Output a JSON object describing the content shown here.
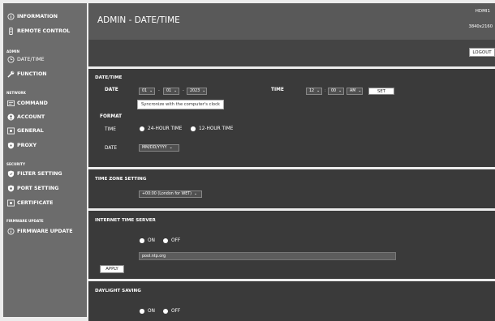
{
  "sidebar": {
    "information": "INFORMATION",
    "remote_control": "REMOTE CONTROL",
    "cat_admin": "ADMIN",
    "date_time": "DATE/TIME",
    "function": "FUNCTION",
    "cat_network": "NETWORK",
    "command": "COMMAND",
    "account": "ACCOUNT",
    "general": "GENERAL",
    "proxy": "PROXY",
    "cat_security": "SECURITY",
    "filter_setting": "FILTER SETTING",
    "port_setting": "PORT SETTING",
    "certificate": "CERTIFICATE",
    "cat_firmware": "FIRMWARE UPDATE",
    "firmware_update": "FIRMWARE UPDATE"
  },
  "header": {
    "title": "ADMIN - DATE/TIME",
    "input_source": "HDMI1",
    "resolution": "3840x2160",
    "logout": "LOGOUT"
  },
  "datetime": {
    "section_title": "DATE/TIME",
    "date_label": "DATE",
    "month": "01",
    "day": "01",
    "year": "2023",
    "date_sep1": "-",
    "date_sep2": "-",
    "time_label": "TIME",
    "hour": "12",
    "minute": "00",
    "ampm": "AM",
    "time_sep": ":",
    "set_button": "SET",
    "sync_tooltip": "Syncronize with the computer's clock",
    "format_title": "FORMAT",
    "format_time_label": "TIME",
    "opt_24h": "24-HOUR TIME",
    "opt_12h": "12-HOUR TIME",
    "format_date_label": "DATE",
    "date_format": "MM/DD/YYYY"
  },
  "timezone": {
    "section_title": "TIME ZONE SETTING",
    "value": "+00:00 (London for WET)"
  },
  "ntp": {
    "section_title": "INTERNET TIME SERVER",
    "on_label": "ON",
    "off_label": "OFF",
    "server": "pool.ntp.org",
    "apply_button": "APPLY"
  },
  "dst": {
    "section_title": "DAYLIGHT SAVING",
    "on_label": "ON",
    "off_label": "OFF"
  },
  "colors": {
    "sidebar_bg": "#6c6c6c",
    "header_bg": "#595959",
    "section_bg": "#3a3a3a",
    "page_bg": "#ececec"
  }
}
